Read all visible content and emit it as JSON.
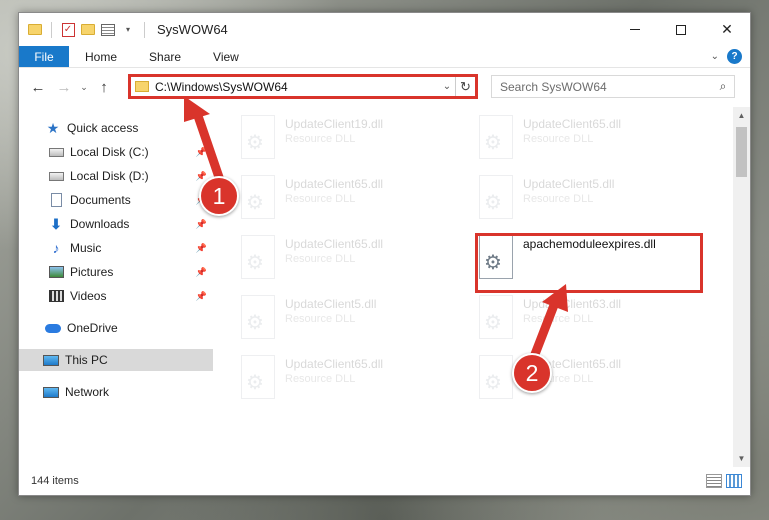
{
  "window": {
    "title": "SysWOW64"
  },
  "ribbon": {
    "tabs": [
      {
        "label": "File"
      },
      {
        "label": "Home"
      },
      {
        "label": "Share"
      },
      {
        "label": "View"
      }
    ],
    "help_label": "?"
  },
  "navigation": {
    "address": "C:\\Windows\\SysWOW64",
    "search_placeholder": "Search SysWOW64"
  },
  "sidebar": {
    "items": [
      {
        "label": "Quick access",
        "icon": "star-icon"
      },
      {
        "label": "Local Disk (C:)",
        "icon": "disk-icon",
        "pinned": true
      },
      {
        "label": "Local Disk (D:)",
        "icon": "disk-icon",
        "pinned": true
      },
      {
        "label": "Documents",
        "icon": "documents-icon",
        "pinned": true
      },
      {
        "label": "Downloads",
        "icon": "download-icon",
        "pinned": true
      },
      {
        "label": "Music",
        "icon": "music-icon",
        "pinned": true
      },
      {
        "label": "Pictures",
        "icon": "pictures-icon",
        "pinned": true
      },
      {
        "label": "Videos",
        "icon": "videos-icon",
        "pinned": true
      },
      {
        "label": "OneDrive",
        "icon": "cloud-icon"
      },
      {
        "label": "This PC",
        "icon": "computer-icon",
        "selected": true
      },
      {
        "label": "Network",
        "icon": "network-icon"
      }
    ]
  },
  "files": [
    {
      "name": "UpdateClient19.dll",
      "type": "Resource DLL",
      "faded": true
    },
    {
      "name": "UpdateClient65.dll",
      "type": "Resource DLL",
      "faded": true
    },
    {
      "name": "UpdateClient65.dll",
      "type": "Resource DLL",
      "faded": true
    },
    {
      "name": "UpdateClient5.dll",
      "type": "Resource DLL",
      "faded": true
    },
    {
      "name": "UpdateClient65.dll",
      "type": "Resource DLL",
      "faded": true
    },
    {
      "name": "apachemoduleexpires.dll",
      "type": "",
      "faded": false
    },
    {
      "name": "UpdateClient5.dll",
      "type": "Resource DLL",
      "faded": true
    },
    {
      "name": "UpdateClient63.dll",
      "type": "Resource DLL",
      "faded": true
    },
    {
      "name": "UpdateClient65.dll",
      "type": "Resource DLL",
      "faded": true
    },
    {
      "name": "UpdateClient65.dll",
      "type": "Resource DLL",
      "faded": true
    }
  ],
  "status": {
    "item_count": "144 items"
  },
  "annotations": {
    "step1": "1",
    "step2": "2",
    "color": "#d9342b"
  }
}
